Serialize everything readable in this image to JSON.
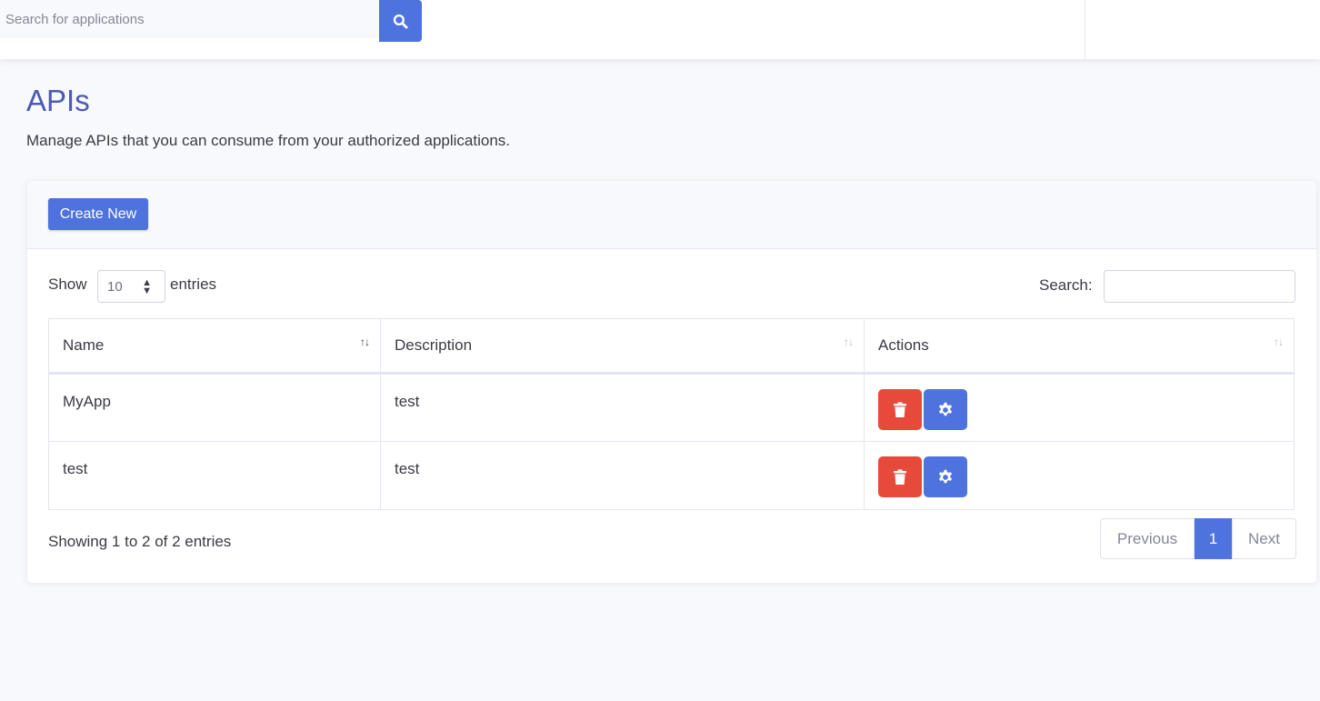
{
  "topbar": {
    "search_placeholder": "Search for applications",
    "search_icon": "search-icon"
  },
  "page": {
    "title": "APIs",
    "subtitle": "Manage APIs that you can consume from your authorized applications."
  },
  "card": {
    "create_label": "Create New",
    "show_label": "Show",
    "entries_value": "10",
    "entries_label": "entries",
    "search_label": "Search:",
    "search_value": ""
  },
  "table": {
    "headers": [
      "Name",
      "Description",
      "Actions"
    ],
    "rows": [
      {
        "name": "MyApp",
        "description": "test"
      },
      {
        "name": "test",
        "description": "test"
      }
    ],
    "action_icons": [
      "trash-icon",
      "gear-icon"
    ]
  },
  "footer": {
    "info": "Showing 1 to 2 of 2 entries",
    "pagination": {
      "previous": "Previous",
      "current": "1",
      "next": "Next"
    }
  },
  "colors": {
    "primary": "#4e73df",
    "danger": "#e74a3b",
    "title": "#4a5bb3",
    "background": "#f8f9fc"
  }
}
